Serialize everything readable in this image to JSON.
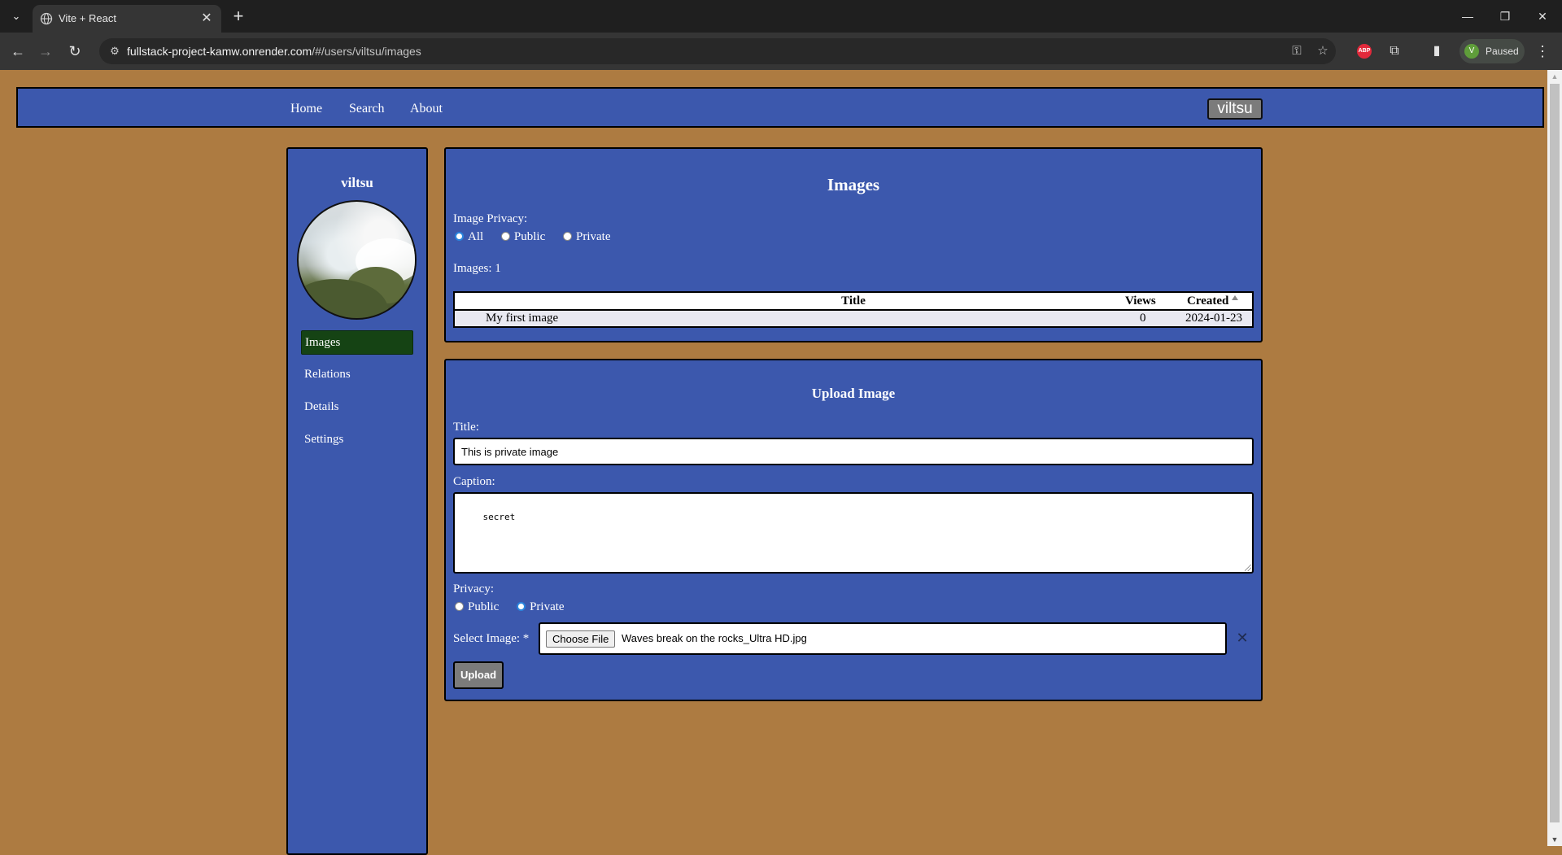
{
  "browser": {
    "tab_title": "Vite + React",
    "url_host": "fullstack-project-kamw.onrender.com",
    "url_path": "/#/users/viltsu/images",
    "profile_initial": "V",
    "profile_status": "Paused",
    "extension_label": "ABP"
  },
  "nav": {
    "links": [
      "Home",
      "Search",
      "About"
    ],
    "user_button": "viltsu"
  },
  "sidebar": {
    "username": "viltsu",
    "items": [
      {
        "label": "Images",
        "active": true
      },
      {
        "label": "Relations",
        "active": false
      },
      {
        "label": "Details",
        "active": false
      },
      {
        "label": "Settings",
        "active": false
      }
    ]
  },
  "images_panel": {
    "title": "Images",
    "privacy_label": "Image Privacy:",
    "privacy_options": [
      {
        "label": "All",
        "checked": true
      },
      {
        "label": "Public",
        "checked": false
      },
      {
        "label": "Private",
        "checked": false
      }
    ],
    "count_label": "Images: 1",
    "table": {
      "columns": [
        "Title",
        "Views",
        "Created"
      ],
      "rows": [
        {
          "title": "My first image",
          "views": "0",
          "created": "2024-01-23"
        }
      ]
    }
  },
  "upload_panel": {
    "title": "Upload Image",
    "title_label": "Title:",
    "title_value": "This is private image",
    "caption_label": "Caption:",
    "caption_value": "secret",
    "privacy_label": "Privacy:",
    "privacy_options": [
      {
        "label": "Public",
        "checked": false
      },
      {
        "label": "Private",
        "checked": true
      }
    ],
    "select_label": "Select Image: *",
    "choose_file_label": "Choose File",
    "file_name": "Waves break on the rocks_Ultra HD.jpg",
    "clear_symbol": "✕",
    "upload_label": "Upload"
  },
  "colors": {
    "page_bg": "#ad7b41",
    "panel_bg": "#3c58ad",
    "active_item_bg": "#154314",
    "button_gray": "#7b7b7b"
  }
}
